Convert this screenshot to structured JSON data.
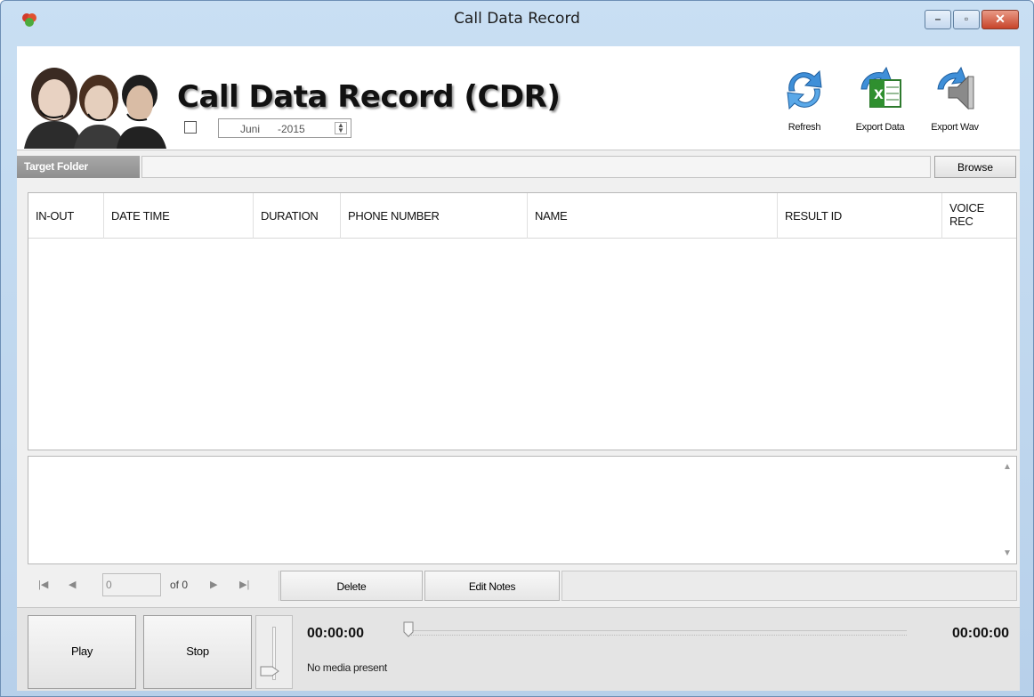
{
  "window": {
    "title": "Call Data Record"
  },
  "header": {
    "title": "Call Data Record (CDR)",
    "date_month": "Juni",
    "date_year": "-2015"
  },
  "toolbar": {
    "refresh_label": "Refresh",
    "export_data_label": "Export Data",
    "export_wav_label": "Export Wav"
  },
  "folder": {
    "label": "Target Folder",
    "value": "",
    "browse_label": "Browse"
  },
  "grid": {
    "columns": [
      "IN-OUT",
      "DATE TIME",
      "DURATION",
      "PHONE NUMBER",
      "NAME",
      "RESULT ID",
      "VOICE REC"
    ],
    "rows": []
  },
  "navigator": {
    "position": "0",
    "of_label": "of 0"
  },
  "actions": {
    "delete_label": "Delete",
    "edit_notes_label": "Edit Notes"
  },
  "media": {
    "play_label": "Play",
    "stop_label": "Stop",
    "current_time": "00:00:00",
    "total_time": "00:00:00",
    "status": "No media present"
  },
  "colors": {
    "title_bar": "#c9dff3",
    "close_button": "#c7442a",
    "folder_label_bg": "#999999"
  },
  "icons": [
    "app-icon",
    "refresh-icon",
    "excel-export-icon",
    "wav-export-icon",
    "first-icon",
    "prev-icon",
    "next-icon",
    "last-icon",
    "volume-thumb-icon"
  ]
}
